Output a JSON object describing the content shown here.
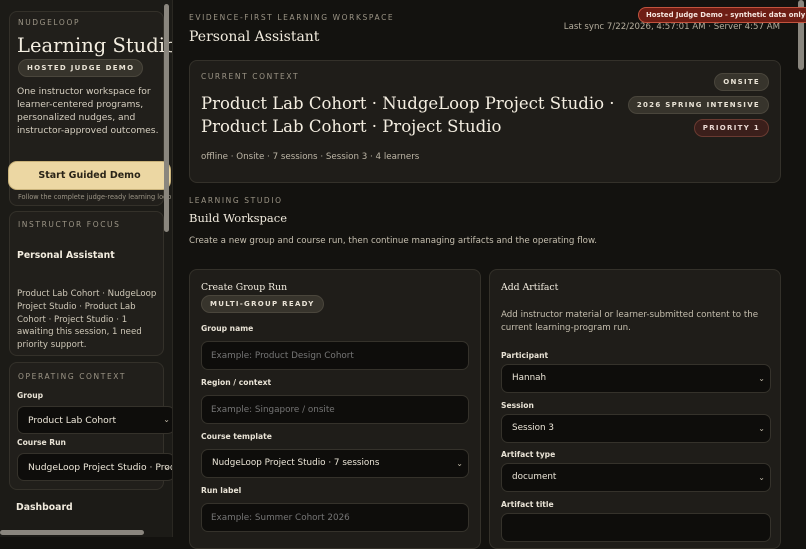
{
  "sidebar": {
    "brand_eyebrow": "NUDGELOOP",
    "brand_title": "Learning Studio",
    "brand_pill": "HOSTED JUDGE DEMO",
    "brand_desc": "One instructor workspace for learner-centered programs, personalized nudges, and instructor-approved outcomes.",
    "guided_button": "Start Guided Demo",
    "guided_sub": "Follow the complete judge-ready learning loop",
    "focus_eyebrow": "INSTRUCTOR FOCUS",
    "focus_title": "Personal Assistant",
    "focus_text": "Product Lab Cohort · NudgeLoop Project Studio · Product Lab Cohort · Project Studio · 1 awaiting this session, 1 need priority support.",
    "ops_eyebrow": "OPERATING CONTEXT",
    "group_label": "Group",
    "group_value": "Product Lab Cohort",
    "course_run_label": "Course Run",
    "course_run_value": "NudgeLoop Project Studio · Product Lab Cohort",
    "dashboard_label": "Dashboard"
  },
  "header": {
    "eyebrow": "EVIDENCE-FIRST LEARNING WORKSPACE",
    "title": "Personal Assistant",
    "sync": "Last sync 7/22/2026, 4:57:01 AM · Server 4:57 AM",
    "demo_badge": "Hosted Judge Demo - synthetic data only"
  },
  "context": {
    "eyebrow": "CURRENT CONTEXT",
    "title": "Product Lab Cohort · NudgeLoop Project Studio · Product Lab Cohort · Project Studio",
    "meta": "offline · Onsite · 7 sessions · Session 3 · 4 learners",
    "badges": [
      "ONSITE",
      "2026 SPRING INTENSIVE",
      "PRIORITY 1"
    ]
  },
  "workspace": {
    "eyebrow": "LEARNING STUDIO",
    "title": "Build Workspace",
    "desc": "Create a new group and course run, then continue managing artifacts and the operating flow."
  },
  "group_form": {
    "title": "Create Group Run",
    "pill": "MULTI-GROUP READY",
    "group_name_label": "Group name",
    "group_name_placeholder": "Example: Product Design Cohort",
    "region_label": "Region / context",
    "region_placeholder": "Example: Singapore / onsite",
    "template_label": "Course template",
    "template_value": "NudgeLoop Project Studio · 7 sessions",
    "run_label_label": "Run label",
    "run_label_placeholder": "Example: Summer Cohort 2026"
  },
  "artifact_form": {
    "title": "Add Artifact",
    "desc": "Add instructor material or learner-submitted content to the current learning-program run.",
    "participant_label": "Participant",
    "participant_value": "Hannah",
    "session_label": "Session",
    "session_value": "Session 3",
    "type_label": "Artifact type",
    "type_value": "document",
    "title_label": "Artifact title"
  }
}
